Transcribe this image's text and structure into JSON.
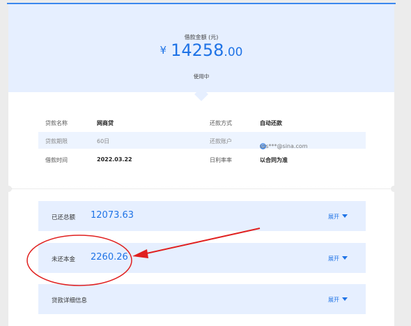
{
  "loan": {
    "amount_label": "借款金额 (元)",
    "currency_symbol": "¥",
    "amount_integer": "14258",
    "amount_decimal": ".00",
    "status": "使用中"
  },
  "details": [
    {
      "k1": "贷款名称",
      "v1": "网商贷",
      "k2": "还款方式",
      "v2": "自动还款"
    },
    {
      "k1": "贷款期限",
      "v1": "60日",
      "k2": "还款账户",
      "v2": "szs***@sina.com"
    },
    {
      "k1": "借款时间",
      "v1": "2022.03.22",
      "k2": "日利率率",
      "v2": "以合同为准"
    }
  ],
  "sections": [
    {
      "label": "已还总额",
      "value": "12073.63",
      "toggle": "展开"
    },
    {
      "label": "未还本金",
      "value": "2260.26",
      "toggle": "展开"
    },
    {
      "label": "贷款详细信息",
      "value": "",
      "toggle": "展开"
    }
  ],
  "colors": {
    "accent": "#1f73e6",
    "hero_bg": "#e6efff",
    "annotation": "#e0201f"
  }
}
